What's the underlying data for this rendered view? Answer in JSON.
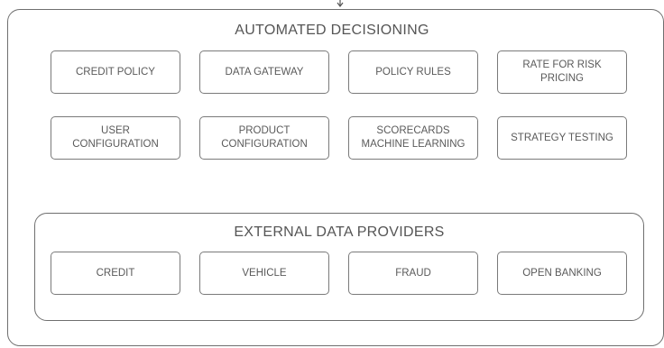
{
  "automated": {
    "title": "AUTOMATED DECISIONING",
    "boxes": [
      "CREDIT POLICY",
      "DATA GATEWAY",
      "POLICY RULES",
      "RATE FOR RISK\nPRICING",
      "USER\nCONFIGURATION",
      "PRODUCT\nCONFIGURATION",
      "SCORECARDS\nMACHINE LEARNING",
      "STRATEGY TESTING"
    ]
  },
  "external": {
    "title": "EXTERNAL DATA PROVIDERS",
    "boxes": [
      "CREDIT",
      "VEHICLE",
      "FRAUD",
      "OPEN BANKING"
    ]
  }
}
